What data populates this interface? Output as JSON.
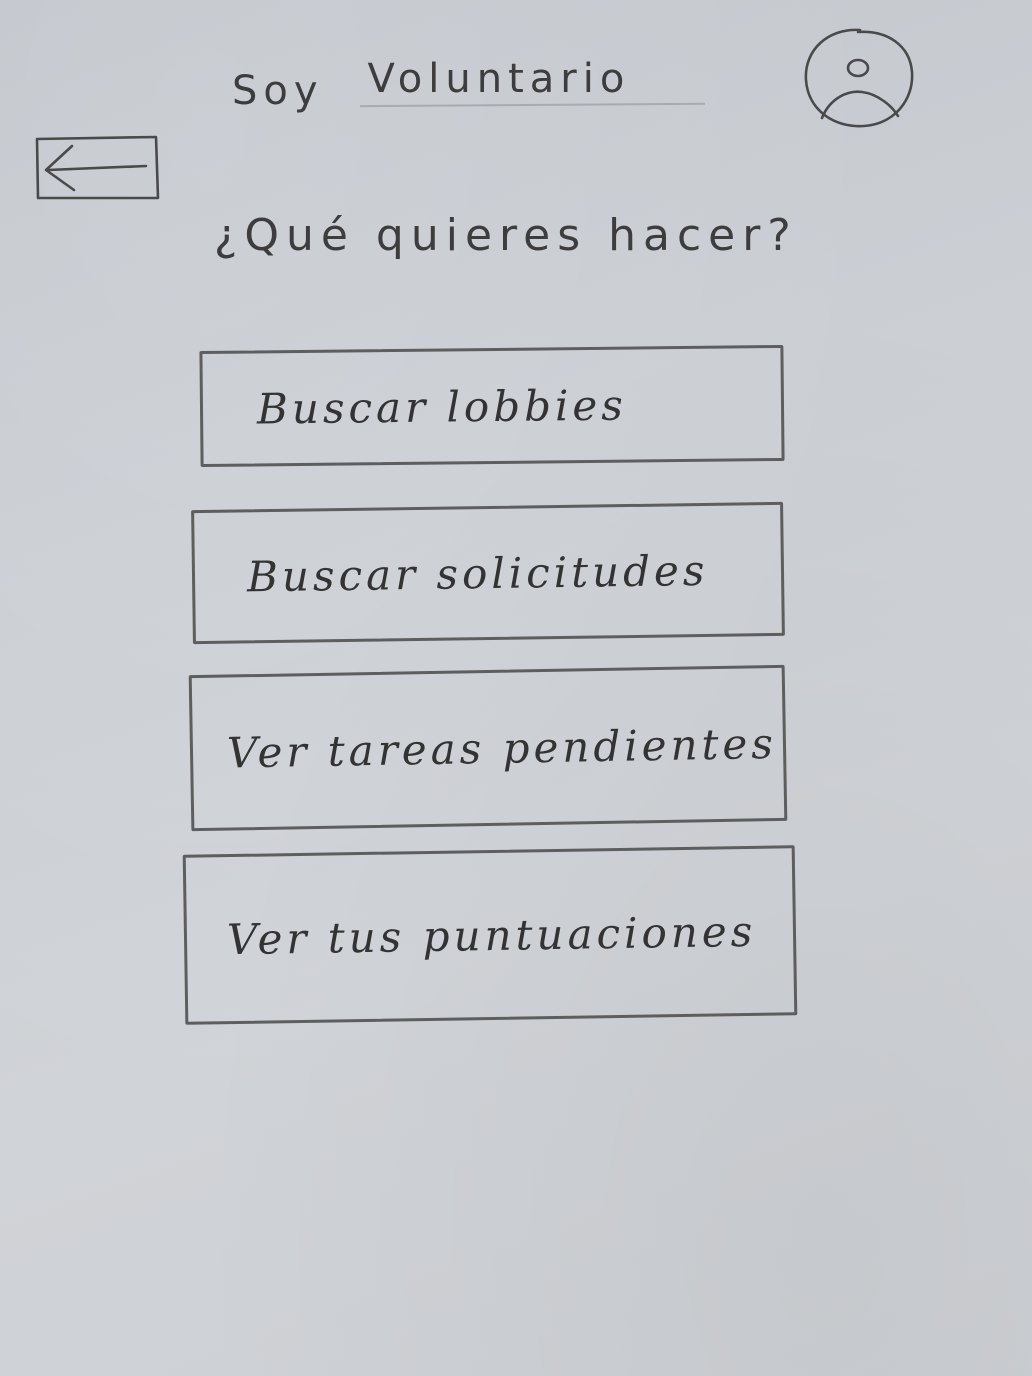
{
  "header": {
    "prefix": "Soy",
    "role": "Voluntario"
  },
  "question": "¿Qué quieres hacer?",
  "menu": {
    "items": [
      {
        "label": "Buscar lobbies"
      },
      {
        "label": "Buscar solicitudes"
      },
      {
        "label": "Ver tareas pendientes"
      },
      {
        "label": "Ver tus puntuaciones"
      }
    ]
  },
  "icons": {
    "back": "arrow-left-icon",
    "profile": "user-avatar-icon"
  }
}
